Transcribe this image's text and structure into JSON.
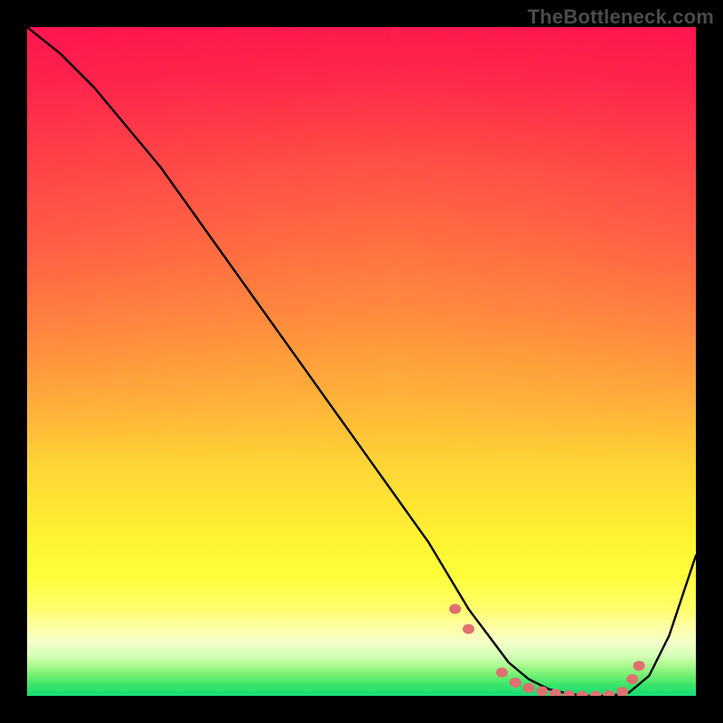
{
  "watermark": "TheBottleneck.com",
  "chart_data": {
    "type": "line",
    "title": "",
    "xlabel": "",
    "ylabel": "",
    "xlim": [
      0,
      100
    ],
    "ylim": [
      0,
      100
    ],
    "series": [
      {
        "name": "bottleneck-curve",
        "x": [
          0,
          5,
          10,
          15,
          20,
          25,
          30,
          35,
          40,
          45,
          50,
          55,
          60,
          63,
          66,
          69,
          72,
          75,
          78,
          81,
          84,
          87,
          90,
          93,
          96,
          100
        ],
        "y": [
          100,
          96,
          91,
          85,
          79,
          72,
          65,
          58,
          51,
          44,
          37,
          30,
          23,
          18,
          13,
          9,
          5,
          2.5,
          1,
          0.3,
          0,
          0,
          0.5,
          3,
          9,
          21
        ]
      }
    ],
    "markers": {
      "name": "highlight-dots",
      "color": "#e07070",
      "points": [
        {
          "x": 64,
          "y": 13
        },
        {
          "x": 66,
          "y": 10
        },
        {
          "x": 71,
          "y": 3.5
        },
        {
          "x": 73,
          "y": 2
        },
        {
          "x": 75,
          "y": 1.2
        },
        {
          "x": 77,
          "y": 0.7
        },
        {
          "x": 79,
          "y": 0.3
        },
        {
          "x": 81,
          "y": 0.1
        },
        {
          "x": 83,
          "y": 0
        },
        {
          "x": 85,
          "y": 0
        },
        {
          "x": 87,
          "y": 0.1
        },
        {
          "x": 89,
          "y": 0.6
        },
        {
          "x": 90.5,
          "y": 2.5
        },
        {
          "x": 91.5,
          "y": 4.5
        }
      ]
    },
    "background_gradient_stops": [
      {
        "pct": 0,
        "color": "#ff1a4e"
      },
      {
        "pct": 30,
        "color": "#ff6a42"
      },
      {
        "pct": 55,
        "color": "#ffb13a"
      },
      {
        "pct": 76,
        "color": "#fff232"
      },
      {
        "pct": 92,
        "color": "#f4ffc8"
      },
      {
        "pct": 100,
        "color": "#17db74"
      }
    ]
  }
}
